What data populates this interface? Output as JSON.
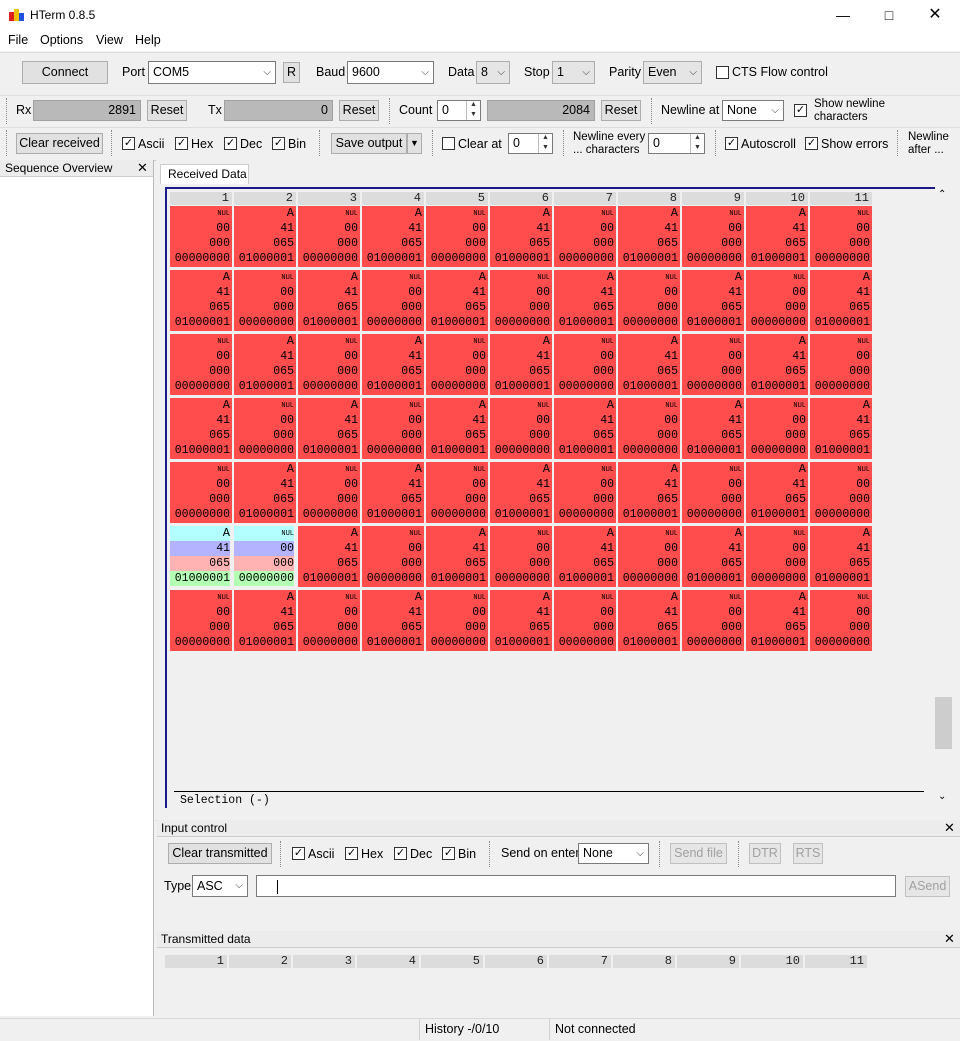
{
  "window": {
    "title": "HTerm 0.8.5"
  },
  "menu": [
    "File",
    "Options",
    "View",
    "Help"
  ],
  "connection": {
    "connect_label": "Connect",
    "port_label": "Port",
    "port_value": "COM5",
    "r_label": "R",
    "baud_label": "Baud",
    "baud_value": "9600",
    "data_label": "Data",
    "data_value": "8",
    "stop_label": "Stop",
    "stop_value": "1",
    "parity_label": "Parity",
    "parity_value": "Even",
    "cts_label": "CTS Flow control",
    "cts_checked": false
  },
  "counters": {
    "rx_label": "Rx",
    "rx_value": "2891",
    "rx_reset": "Reset",
    "tx_label": "Tx",
    "tx_value": "0",
    "tx_reset": "Reset",
    "count_label": "Count",
    "count_value": "0",
    "count_display": "2084",
    "count_reset": "Reset",
    "newline_at_label": "Newline at",
    "newline_at_value": "None",
    "show_newline_label_1": "Show newline",
    "show_newline_label_2": "characters",
    "show_newline_checked": true
  },
  "display": {
    "clear_received": "Clear received",
    "ascii": "Ascii",
    "hex": "Hex",
    "dec": "Dec",
    "bin": "Bin",
    "save_output": "Save output",
    "clear_at_label": "Clear at",
    "clear_at_value": "0",
    "clear_at_checked": false,
    "newline_every_1": "Newline every",
    "newline_every_2": "... characters",
    "newline_every_value": "0",
    "autoscroll": "Autoscroll",
    "show_errors": "Show errors",
    "newline_after_1": "Newline",
    "newline_after_2": "after ..."
  },
  "sequence_overview": {
    "title": "Sequence Overview"
  },
  "received": {
    "tab_label": "Received Data",
    "columns": [
      "1",
      "2",
      "3",
      "4",
      "5",
      "6",
      "7",
      "8",
      "9",
      "10",
      "11"
    ],
    "rows": [
      [
        "N",
        "A",
        "N",
        "A",
        "N",
        "A",
        "N",
        "A",
        "N",
        "A",
        "N"
      ],
      [
        "A",
        "N",
        "A",
        "N",
        "A",
        "N",
        "A",
        "N",
        "A",
        "N",
        "A"
      ],
      [
        "N",
        "A",
        "N",
        "A",
        "N",
        "A",
        "N",
        "A",
        "N",
        "A",
        "N"
      ],
      [
        "A",
        "N",
        "A",
        "N",
        "A",
        "N",
        "A",
        "N",
        "A",
        "N",
        "A"
      ],
      [
        "N",
        "A",
        "N",
        "A",
        "N",
        "A",
        "N",
        "A",
        "N",
        "A",
        "N"
      ],
      [
        "A",
        "N",
        "A",
        "N",
        "A",
        "N",
        "A",
        "N",
        "A",
        "N",
        "A"
      ],
      [
        "N",
        "A",
        "N",
        "A",
        "N",
        "A",
        "N",
        "A",
        "N",
        "A",
        "N"
      ]
    ],
    "selected_row": 5,
    "selected_cols": [
      0,
      1
    ],
    "byte_A": {
      "ascii": "A",
      "hex": "41",
      "dec": "065",
      "bin": "01000001"
    },
    "byte_N": {
      "ascii": "NUL",
      "hex": "00",
      "dec": "000",
      "bin": "00000000"
    },
    "selection_text": "Selection (-)"
  },
  "input_control": {
    "title": "Input control",
    "clear_transmitted": "Clear transmitted",
    "ascii": "Ascii",
    "hex": "Hex",
    "dec": "Dec",
    "bin": "Bin",
    "send_on_enter_label": "Send on enter",
    "send_on_enter_value": "None",
    "send_file": "Send file",
    "dtr": "DTR",
    "rts": "RTS",
    "type_label": "Type",
    "type_value": "ASC",
    "input_value": "",
    "asend": "ASend"
  },
  "transmitted": {
    "title": "Transmitted data",
    "columns": [
      "1",
      "2",
      "3",
      "4",
      "5",
      "6",
      "7",
      "8",
      "9",
      "10",
      "11"
    ]
  },
  "status": {
    "history": "History -/0/10",
    "connection": "Not connected"
  },
  "colors": {
    "cell": "#ff4d4d",
    "sel_ascii": "#b3ffff",
    "sel_hex": "#b3b3ff",
    "sel_dec": "#ffb3b3",
    "sel_bin": "#b3ffb3"
  }
}
